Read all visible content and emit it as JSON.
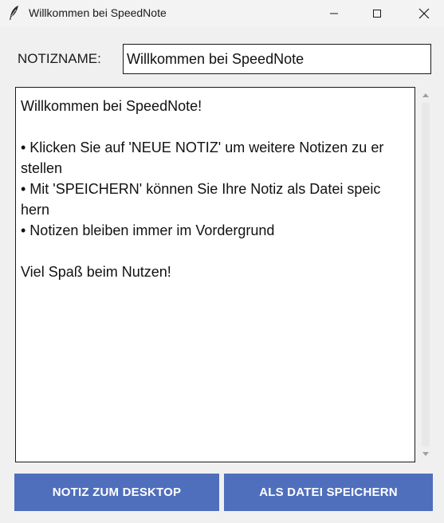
{
  "window": {
    "title": "Willkommen bei SpeedNote",
    "icon": "feather-icon"
  },
  "controls": {
    "minimize": "minimize-icon",
    "maximize": "maximize-icon",
    "close": "close-icon"
  },
  "note_name": {
    "label": "NOTIZNAME:",
    "value": "Willkommen bei SpeedNote"
  },
  "editor": {
    "text": "Willkommen bei SpeedNote!\n\n• Klicken Sie auf 'NEUE NOTIZ' um weitere Notizen zu er\nstellen\n• Mit 'SPEICHERN' können Sie Ihre Notiz als Datei speic\nhern\n• Notizen bleiben immer im Vordergrund\n\nViel Spaß beim Nutzen!"
  },
  "buttons": {
    "desktop": "NOTIZ ZUM DESKTOP",
    "save": "ALS DATEI SPEICHERN"
  },
  "colors": {
    "button_bg": "#4f6fbd",
    "button_text": "#ffffff",
    "background": "#f0f0f0"
  }
}
